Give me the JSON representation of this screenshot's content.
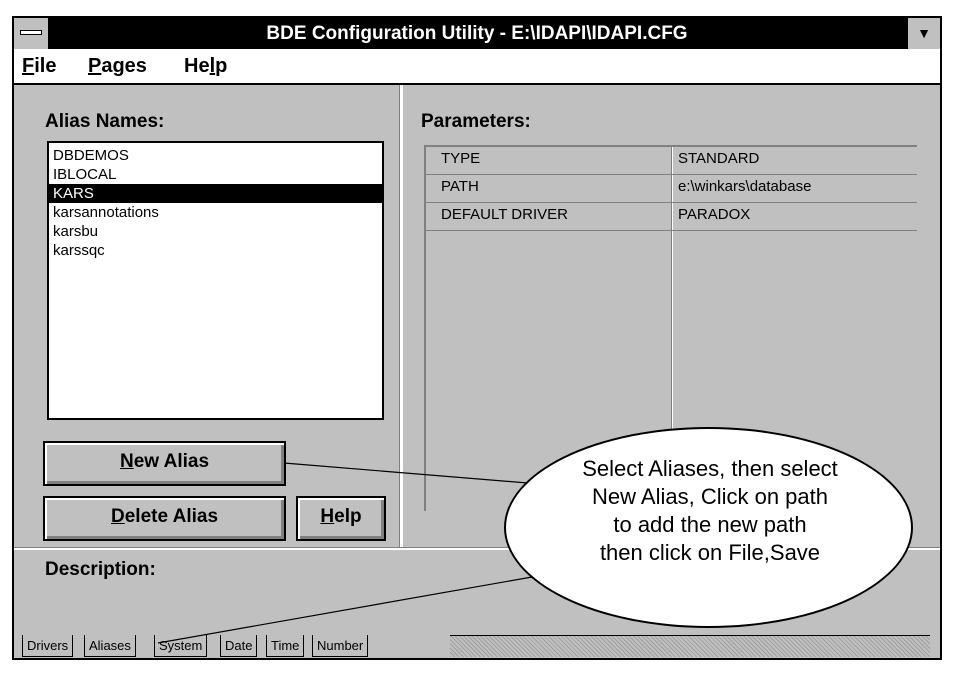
{
  "window": {
    "title": "BDE Configuration Utility - E:\\IDAPI\\IDAPI.CFG"
  },
  "menu": [
    {
      "label_u": "F",
      "label_rest": "ile"
    },
    {
      "label_u": "P",
      "label_rest": "ages"
    },
    {
      "label_pre": "He",
      "label_u": "l",
      "label_rest": "p"
    }
  ],
  "alias_panel": {
    "label": "Alias Names:",
    "items": [
      "DBDEMOS",
      "IBLOCAL",
      "KARS",
      "karsannotations",
      "karsbu",
      "karssqc"
    ],
    "selected": "KARS"
  },
  "buttons": {
    "new_alias_u": "N",
    "new_alias_rest": "ew Alias",
    "delete_alias_u": "D",
    "delete_alias_rest": "elete Alias",
    "help_u": "H",
    "help_rest": "elp"
  },
  "parameters": {
    "label": "Parameters:",
    "rows": [
      {
        "key": "TYPE",
        "value": "STANDARD"
      },
      {
        "key": "PATH",
        "value": "e:\\winkars\\database"
      },
      {
        "key": "DEFAULT DRIVER",
        "value": "PARADOX"
      }
    ]
  },
  "description": {
    "label": "Description:"
  },
  "tabs": [
    "Drivers",
    "Aliases",
    "System",
    "Date",
    "Time",
    "Number"
  ],
  "callout": {
    "lines": [
      "Select Aliases, then select",
      "New Alias, Click on path",
      "to add the new path",
      "then click on File,Save"
    ]
  }
}
